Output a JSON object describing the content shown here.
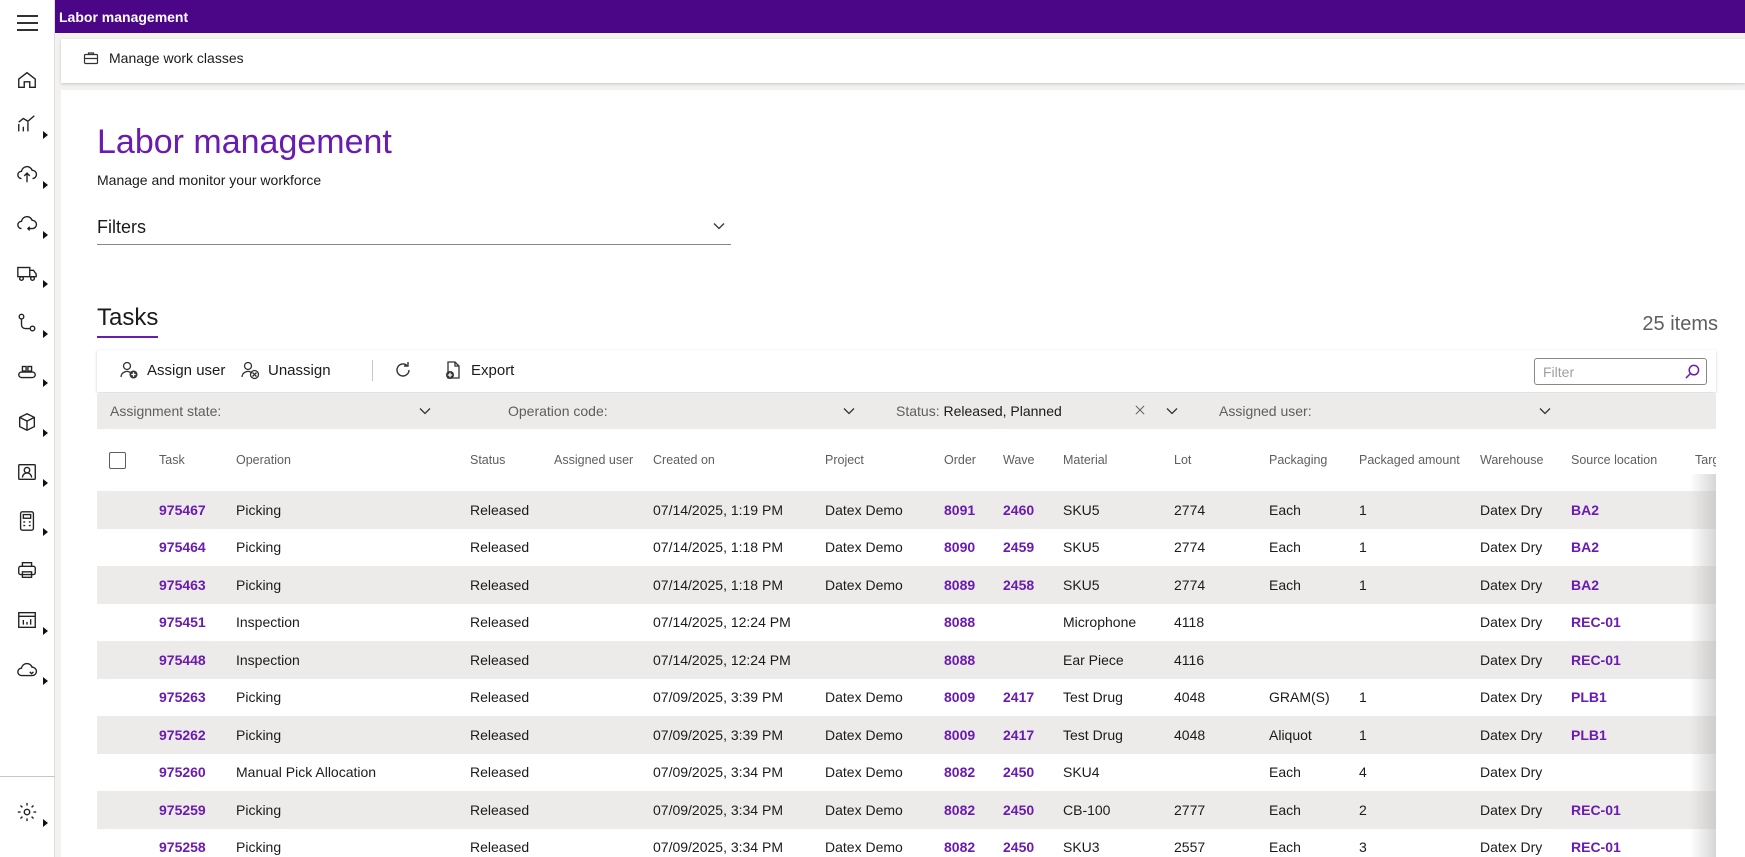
{
  "app": {
    "title": "Labor management"
  },
  "nav": {
    "items": [
      "home-icon",
      "analytics-icon",
      "inbound-icon",
      "outbound-icon",
      "transport-icon",
      "workflow-icon",
      "conveyor-icon",
      "inventory-icon",
      "user-card-icon",
      "calculator-icon",
      "printer-icon",
      "reports-icon",
      "cloud-icon",
      "settings-icon"
    ]
  },
  "commandbar": {
    "manage_work_classes": "Manage work classes"
  },
  "page": {
    "title": "Labor management",
    "subtitle": "Manage and monitor your workforce",
    "filters_label": "Filters"
  },
  "tasks": {
    "tab_label": "Tasks",
    "count_label": "25 items",
    "toolbar": {
      "assign_user": "Assign user",
      "unassign": "Unassign",
      "export": "Export",
      "filter_placeholder": "Filter"
    },
    "chips": {
      "assignment_state": "Assignment state:",
      "operation_code": "Operation code:",
      "status_label": "Status:",
      "status_value": "Released, Planned",
      "assigned_user": "Assigned user:"
    },
    "columns": [
      "Task",
      "Operation",
      "Status",
      "Assigned user",
      "Created on",
      "Project",
      "Order",
      "Wave",
      "Material",
      "Lot",
      "Packaging",
      "Packaged amount",
      "Warehouse",
      "Source location",
      "Targ"
    ],
    "rows": [
      [
        "975467",
        "Picking",
        "Released",
        "",
        "07/14/2025, 1:19 PM",
        "Datex Demo",
        "8091",
        "2460",
        "SKU5",
        "2774",
        "Each",
        "1",
        "Datex Dry",
        "BA2",
        ""
      ],
      [
        "975464",
        "Picking",
        "Released",
        "",
        "07/14/2025, 1:18 PM",
        "Datex Demo",
        "8090",
        "2459",
        "SKU5",
        "2774",
        "Each",
        "1",
        "Datex Dry",
        "BA2",
        ""
      ],
      [
        "975463",
        "Picking",
        "Released",
        "",
        "07/14/2025, 1:18 PM",
        "Datex Demo",
        "8089",
        "2458",
        "SKU5",
        "2774",
        "Each",
        "1",
        "Datex Dry",
        "BA2",
        ""
      ],
      [
        "975451",
        "Inspection",
        "Released",
        "",
        "07/14/2025, 12:24 PM",
        "",
        "8088",
        "",
        "Microphone",
        "4118",
        "",
        "",
        "Datex Dry",
        "REC-01",
        ""
      ],
      [
        "975448",
        "Inspection",
        "Released",
        "",
        "07/14/2025, 12:24 PM",
        "",
        "8088",
        "",
        "Ear Piece",
        "4116",
        "",
        "",
        "Datex Dry",
        "REC-01",
        ""
      ],
      [
        "975263",
        "Picking",
        "Released",
        "",
        "07/09/2025, 3:39 PM",
        "Datex Demo",
        "8009",
        "2417",
        "Test Drug",
        "4048",
        "GRAM(S)",
        "1",
        "Datex Dry",
        "PLB1",
        ""
      ],
      [
        "975262",
        "Picking",
        "Released",
        "",
        "07/09/2025, 3:39 PM",
        "Datex Demo",
        "8009",
        "2417",
        "Test Drug",
        "4048",
        "Aliquot",
        "1",
        "Datex Dry",
        "PLB1",
        ""
      ],
      [
        "975260",
        "Manual Pick Allocation",
        "Released",
        "",
        "07/09/2025, 3:34 PM",
        "Datex Demo",
        "8082",
        "2450",
        "SKU4",
        "",
        "Each",
        "4",
        "Datex Dry",
        "",
        ""
      ],
      [
        "975259",
        "Picking",
        "Released",
        "",
        "07/09/2025, 3:34 PM",
        "Datex Demo",
        "8082",
        "2450",
        "CB-100",
        "2777",
        "Each",
        "2",
        "Datex Dry",
        "REC-01",
        ""
      ],
      [
        "975258",
        "Picking",
        "Released",
        "",
        "07/09/2025, 3:34 PM",
        "Datex Demo",
        "8082",
        "2450",
        "SKU3",
        "2557",
        "Each",
        "3",
        "Datex Dry",
        "REC-01",
        ""
      ]
    ]
  },
  "colors": {
    "brand": "#4b0687",
    "accent": "#6a1bb0"
  }
}
